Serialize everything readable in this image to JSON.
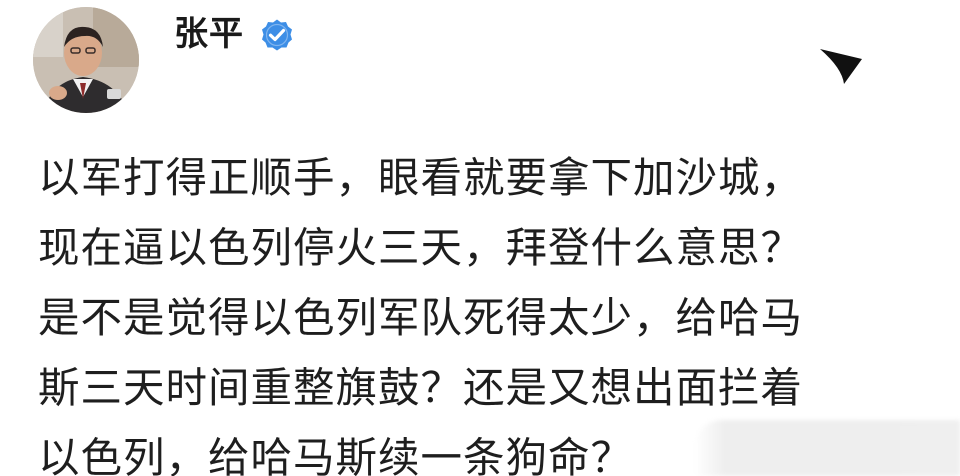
{
  "author": {
    "name": "张平",
    "verified": true,
    "verified_color": "#3d8ee6"
  },
  "icons": {
    "avatar": "avatar",
    "verified": "verified-badge-icon",
    "more": "more-chevron-icon"
  },
  "post": {
    "lines": [
      "以军打得正顺手，眼看就要拿下加沙城，",
      "现在逼以色列停火三天，拜登什么意思？",
      "是不是觉得以色列军队死得太少，给哈马",
      "斯三天时间重整旗鼓？还是又想出面拦着",
      "以色列，给哈马斯续一条狗命？"
    ]
  }
}
